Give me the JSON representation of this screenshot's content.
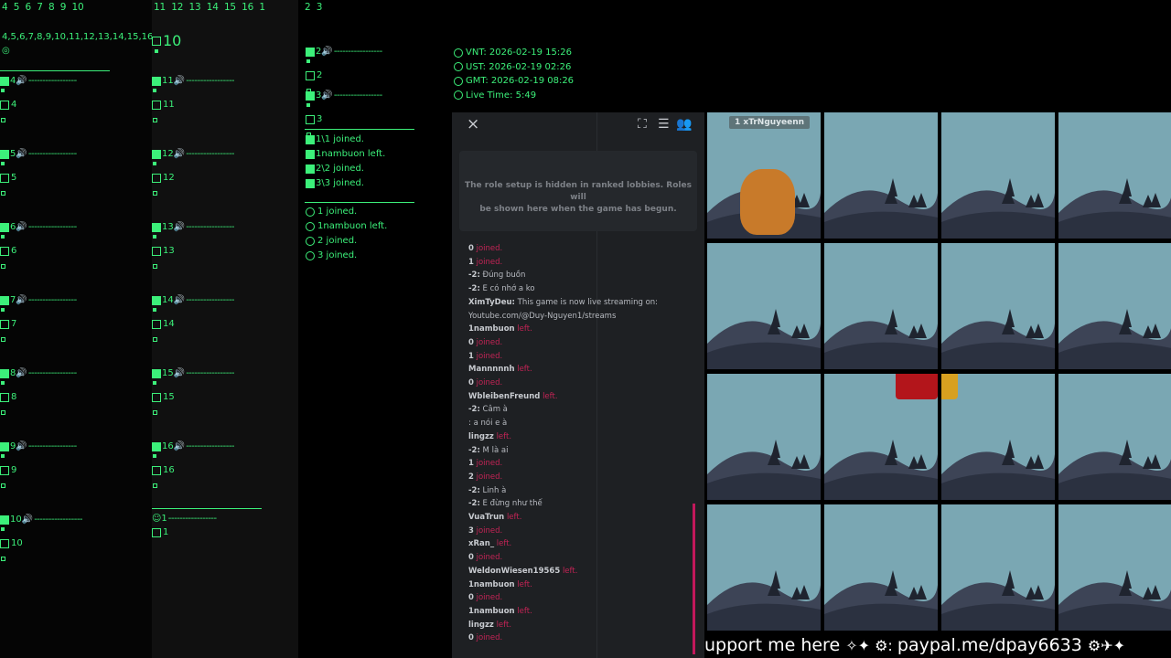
{
  "col1": {
    "header": "4  5  6  7  8  9  10",
    "sub": "4,5,6,7,8,9,10,11,12,13,14,15,16",
    "slots": [
      "4",
      "5",
      "6",
      "7",
      "8",
      "9",
      "10"
    ]
  },
  "col2": {
    "header": "11  12  13  14  15  16  1",
    "slots": [
      "10",
      "11",
      "12",
      "13",
      "14",
      "15",
      "16"
    ],
    "dead_slot": "1"
  },
  "col3": {
    "header": "2  3",
    "slots": [
      "2",
      "3"
    ],
    "log1": [
      "1\\1 joined.",
      "1nambuon left.",
      "2\\2 joined.",
      "3\\3 joined."
    ],
    "log2": [
      "1 joined.",
      "1nambuon left.",
      "2 joined.",
      "3 joined."
    ]
  },
  "times": {
    "vnt": "VNT: 2026-02-19 15:26",
    "ust": "UST: 2026-02-19 02:26",
    "gmt": "GMT: 2026-02-19 08:26",
    "live": "Live Time: 5:49"
  },
  "panel": {
    "close": "×",
    "roles_line1": "The role setup is hidden in ranked lobbies. Roles will",
    "roles_line2": "be shown here when the game has begun.",
    "chat": [
      {
        "n": "0",
        "m": "joined.",
        "t": "j"
      },
      {
        "n": "1",
        "m": "joined.",
        "t": "j"
      },
      {
        "n": "-2:",
        "m": "Đúng buồn",
        "t": "m"
      },
      {
        "n": "-2:",
        "m": "E có nhớ a ko",
        "t": "m"
      },
      {
        "n": "XimTyDeu:",
        "m": "This game is now live streaming on:",
        "t": "m"
      },
      {
        "n": "",
        "m": "Youtube.com/@Duy-Nguyen1/streams",
        "t": "m"
      },
      {
        "n": "1nambuon",
        "m": "left.",
        "t": "j"
      },
      {
        "n": "0",
        "m": "joined.",
        "t": "j"
      },
      {
        "n": "1",
        "m": "joined.",
        "t": "j"
      },
      {
        "n": "Mannnnnh",
        "m": "left.",
        "t": "j"
      },
      {
        "n": "0",
        "m": "joined.",
        "t": "j"
      },
      {
        "n": "WbleibenFreund",
        "m": "left.",
        "t": "j"
      },
      {
        "n": "-2:",
        "m": "Câm à",
        "t": "m"
      },
      {
        "n": "",
        "m": ": a nói e à",
        "t": "m"
      },
      {
        "n": "lingzz",
        "m": "left.",
        "t": "j"
      },
      {
        "n": "-2:",
        "m": "M là ai",
        "t": "m"
      },
      {
        "n": "1",
        "m": "joined.",
        "t": "j"
      },
      {
        "n": "2",
        "m": "joined.",
        "t": "j"
      },
      {
        "n": "-2:",
        "m": "Linh à",
        "t": "m"
      },
      {
        "n": "-2:",
        "m": "E đừng như thế",
        "t": "m"
      },
      {
        "n": "VuaTrun",
        "m": "left.",
        "t": "j"
      },
      {
        "n": "3",
        "m": "joined.",
        "t": "j"
      },
      {
        "n": "xRan_",
        "m": "left.",
        "t": "j"
      },
      {
        "n": "0",
        "m": "joined.",
        "t": "j"
      },
      {
        "n": "WeldonWiesen19565",
        "m": "left.",
        "t": "j"
      },
      {
        "n": "1nambuon",
        "m": "left.",
        "t": "j"
      },
      {
        "n": "0",
        "m": "joined.",
        "t": "j"
      },
      {
        "n": "1nambuon",
        "m": "left.",
        "t": "j"
      },
      {
        "n": "lingzz",
        "m": "left.",
        "t": "j"
      },
      {
        "n": "0",
        "m": "joined.",
        "t": "j"
      }
    ]
  },
  "grid": {
    "player_name": "1 xTrNguyeenn"
  },
  "banner": {
    "text": "upport me here",
    "link": "paypal.me/dpay6633"
  },
  "colors": {
    "accent": "#3cf07a",
    "left_red": "#e0245e",
    "panel": "#1e2023",
    "sky": "#7aa7b3"
  }
}
